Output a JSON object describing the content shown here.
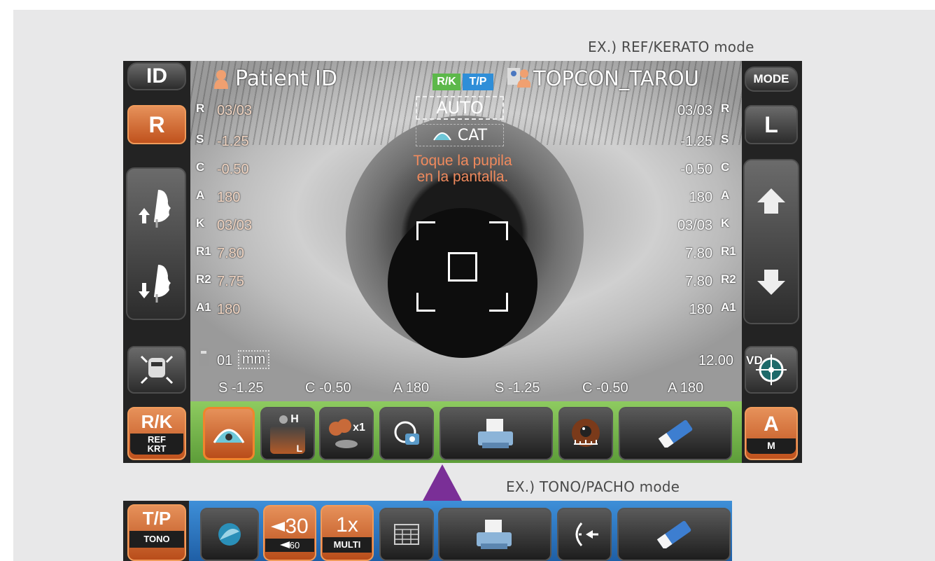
{
  "captions": {
    "top": "EX.) REF/KERATO mode",
    "bottom": "EX.) TONO/PACHO mode"
  },
  "header": {
    "patient_label": "Patient ID",
    "mode_badges": [
      "R/K",
      "T/P"
    ],
    "patient_name": "TOPCON_TAROU",
    "auto_label": "AUTO",
    "cat_label": "CAT",
    "instruction_line1": "Toque la pupila",
    "instruction_line2": "en la pantalla."
  },
  "left_buttons": {
    "id": "ID",
    "eye": "R",
    "mode_top": "R/K",
    "mode_sub1": "REF",
    "mode_sub2": "KRT"
  },
  "right_buttons": {
    "mode": "MODE",
    "eye": "L",
    "auto_top": "A",
    "auto_sub": "M"
  },
  "right_eye": {
    "rows": [
      {
        "label": "R",
        "value": "03/03"
      },
      {
        "label": "S",
        "value": "-1.25"
      },
      {
        "label": "C",
        "value": "-0.50"
      },
      {
        "label": "A",
        "value": "180"
      },
      {
        "label": "K",
        "value": "03/03"
      },
      {
        "label": "R1",
        "value": "7.80"
      },
      {
        "label": "R2",
        "value": "7.75"
      },
      {
        "label": "A1",
        "value": "180"
      }
    ]
  },
  "left_eye": {
    "rows": [
      {
        "label": "R",
        "value": "03/03"
      },
      {
        "label": "S",
        "value": "-1.25"
      },
      {
        "label": "C",
        "value": "-0.50"
      },
      {
        "label": "A",
        "value": "180"
      },
      {
        "label": "K",
        "value": "03/03"
      },
      {
        "label": "R1",
        "value": "7.80"
      },
      {
        "label": "R2",
        "value": "7.80"
      },
      {
        "label": "A1",
        "value": "180"
      }
    ]
  },
  "footer_info": {
    "counter": "01",
    "unit": "mm",
    "vd_value": "12.00",
    "vd_label": "VD",
    "summary_right": {
      "s": "S -1.25",
      "c": "C -0.50",
      "a": "A 180"
    },
    "summary_left": {
      "s": "S -1.25",
      "c": "C -0.50",
      "a": "A 180"
    }
  },
  "toolbar_rk": {
    "height_h": "H",
    "height_l": "L",
    "multi_x1": "x1"
  },
  "toolbar_tp": {
    "mode_top": "T/P",
    "mode_sub": "TONO",
    "value_30": "30",
    "value_60": "60",
    "multi_top": "1x",
    "multi_sub": "MULTI"
  },
  "colors": {
    "accent_orange": "#e07a3f",
    "rk_bar": "#6fb547",
    "tp_bar": "#2f79c4",
    "instruction": "#f08a5d",
    "arrow": "#7a2f97"
  }
}
